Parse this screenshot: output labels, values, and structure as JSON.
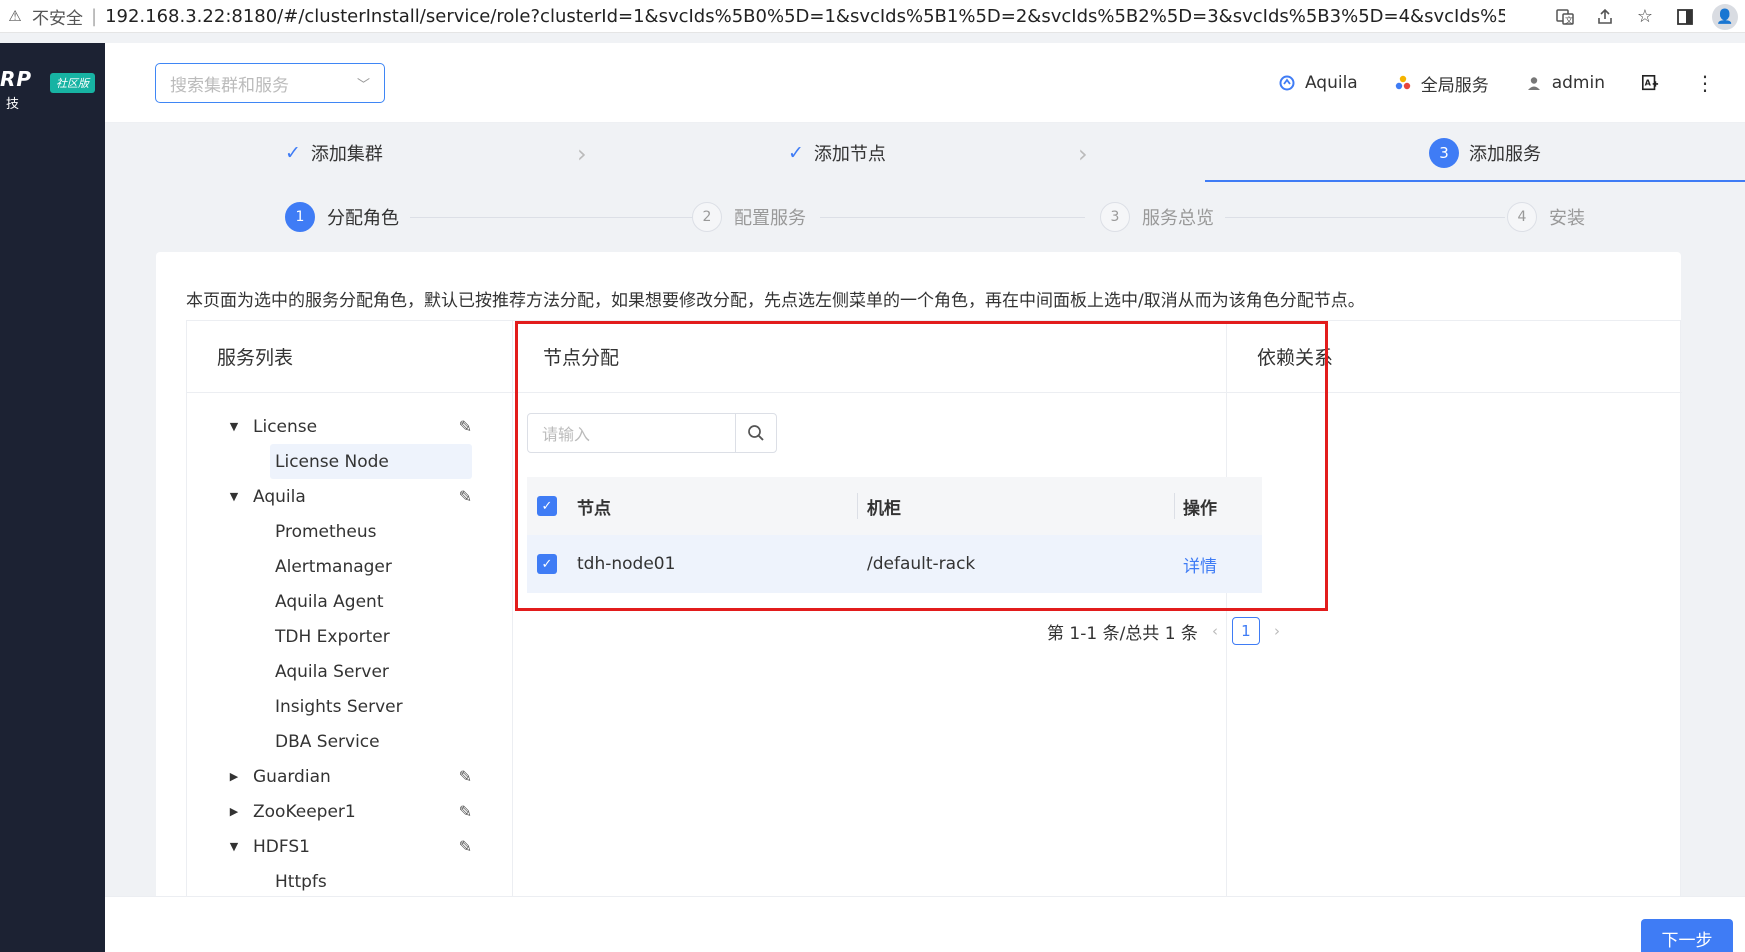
{
  "browser": {
    "security": "不安全",
    "separator": "|",
    "url": "192.168.3.22:8180/#/clusterInstall/service/role?clusterId=1&svcIds%5B0%5D=1&svcIds%5B1%5D=2&svcIds%5B2%5D=3&svcIds%5B3%5D=4&svcIds%5B4%5D=5&s...",
    "icons": [
      "translate-icon",
      "share-icon",
      "star-icon",
      "side-panel-icon",
      "profile-icon"
    ]
  },
  "sidebar": {
    "logo": "RP",
    "badge": "社区版",
    "sub": "技"
  },
  "header": {
    "search_placeholder": "搜索集群和服务",
    "aquila": "Aquila",
    "global_services": "全局服务",
    "user": "admin"
  },
  "steps": {
    "s1": "添加集群",
    "s2": "添加节点",
    "s3_num": "3",
    "s3": "添加服务"
  },
  "substeps": [
    {
      "num": "1",
      "label": "分配角色"
    },
    {
      "num": "2",
      "label": "配置服务"
    },
    {
      "num": "3",
      "label": "服务总览"
    },
    {
      "num": "4",
      "label": "安装"
    }
  ],
  "description": "本页面为选中的服务分配角色，默认已按推荐方法分配，如果想要修改分配，先点选左侧菜单的一个角色，再在中间面板上选中/取消从而为该角色分配节点。",
  "panels": {
    "services_title": "服务列表",
    "nodes_title": "节点分配",
    "deps_title": "依赖关系"
  },
  "tree": {
    "license": "License",
    "license_node": "License Node",
    "aquila": "Aquila",
    "prometheus": "Prometheus",
    "alertmanager": "Alertmanager",
    "aquila_agent": "Aquila Agent",
    "tdh_exporter": "TDH Exporter",
    "aquila_server": "Aquila Server",
    "insights_server": "Insights Server",
    "dba_service": "DBA Service",
    "guardian": "Guardian",
    "zookeeper": "ZooKeeper1",
    "hdfs": "HDFS1",
    "httpfs": "Httpfs"
  },
  "node_table": {
    "search_placeholder": "请输入",
    "col_node": "节点",
    "col_rack": "机柜",
    "col_action": "操作",
    "row_node": "tdh-node01",
    "row_rack": "/default-rack",
    "row_action": "详情"
  },
  "pager": {
    "summary": "第 1-1 条/总共 1 条",
    "page": "1"
  },
  "footer": {
    "next": "下一步"
  },
  "colors": {
    "primary": "#3f7cf5",
    "highlight": "#e21c1c",
    "sidebar": "#1c2233"
  }
}
